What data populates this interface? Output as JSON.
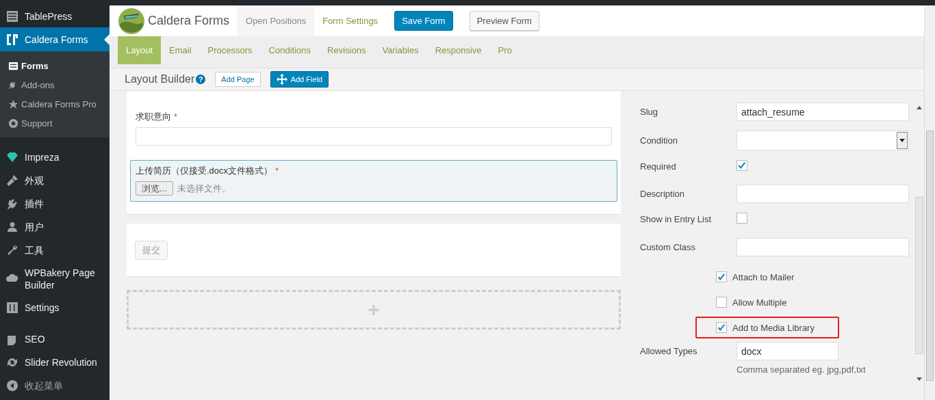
{
  "sidebar": {
    "items": [
      {
        "label": "TablePress",
        "selected": false
      },
      {
        "label": "Caldera Forms",
        "selected": true,
        "children": [
          {
            "label": "Forms",
            "selected": true
          },
          {
            "label": "Add-ons",
            "selected": false
          },
          {
            "label": "Caldera Forms Pro",
            "selected": false
          },
          {
            "label": "Support",
            "selected": false
          }
        ]
      },
      {
        "label": "Impreza",
        "selected": false
      },
      {
        "label": "外观",
        "selected": false
      },
      {
        "label": "插件",
        "selected": false
      },
      {
        "label": "用户",
        "selected": false
      },
      {
        "label": "工具",
        "selected": false
      },
      {
        "label": "WPBakery Page Builder",
        "selected": false
      },
      {
        "label": "Settings",
        "selected": false
      },
      {
        "label": "SEO",
        "selected": false
      },
      {
        "label": "Slider Revolution",
        "selected": false
      },
      {
        "label": "收起菜单",
        "selected": false
      }
    ]
  },
  "header": {
    "brand": "Caldera Forms",
    "form_name": "Open Positions",
    "form_settings": "Form Settings",
    "save": "Save Form",
    "preview": "Preview Form"
  },
  "tabs": [
    {
      "label": "Layout",
      "selected": true
    },
    {
      "label": "Email",
      "selected": false
    },
    {
      "label": "Processors",
      "selected": false
    },
    {
      "label": "Conditions",
      "selected": false
    },
    {
      "label": "Revisions",
      "selected": false
    },
    {
      "label": "Variables",
      "selected": false
    },
    {
      "label": "Responsive",
      "selected": false
    },
    {
      "label": "Pro",
      "selected": false
    }
  ],
  "builder": {
    "title": "Layout Builder",
    "help": "?",
    "add_page": "Add Page",
    "add_field": "Add Field"
  },
  "canvas": {
    "fields": [
      {
        "kind": "text",
        "label": "求职意向",
        "required_mark": "*",
        "selected": false
      },
      {
        "kind": "file",
        "label": "上传简历（仅接受.docx文件格式）",
        "required_mark": "*",
        "selected": true,
        "button": "浏览...",
        "status": "未选择文件。"
      }
    ],
    "submit": "提交",
    "add_row": "+"
  },
  "settings": [
    {
      "kind": "text",
      "label": "Slug",
      "value": "attach_resume"
    },
    {
      "kind": "select",
      "label": "Condition"
    },
    {
      "kind": "checkbox",
      "label": "Required",
      "checked": true
    },
    {
      "kind": "text",
      "label": "Description"
    },
    {
      "kind": "checkbox",
      "label": "Show in Entry List",
      "checked": false
    },
    {
      "kind": "text",
      "label": "Custom Class"
    },
    {
      "kind": "option",
      "label": "Attach to Mailer",
      "checked": true,
      "highlighted": false
    },
    {
      "kind": "option",
      "label": "Allow Multiple",
      "checked": false,
      "highlighted": false
    },
    {
      "kind": "option",
      "label": "Add to Media Library",
      "checked": true,
      "highlighted": true
    },
    {
      "kind": "short",
      "label": "Allowed Types",
      "value": "docx",
      "hint": "Comma separated eg. jpg,pdf,txt"
    }
  ]
}
